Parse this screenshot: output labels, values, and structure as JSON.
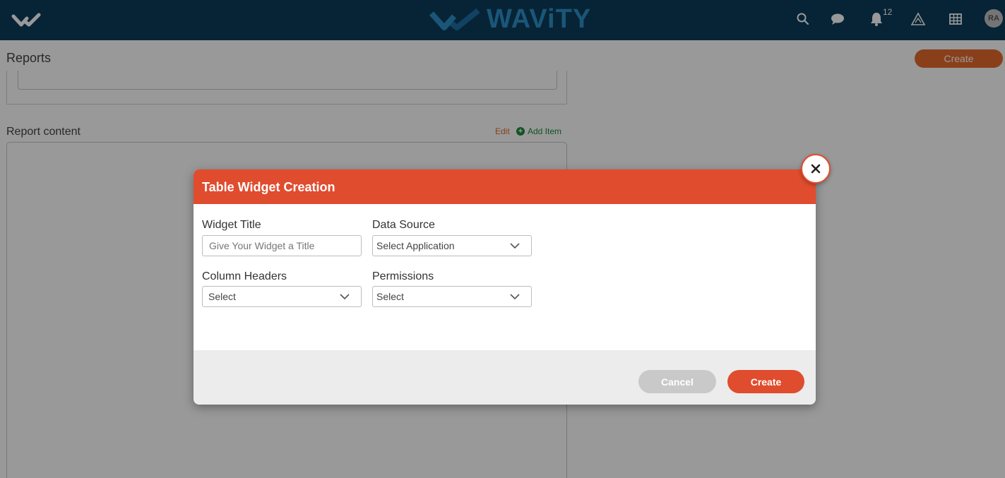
{
  "header": {
    "brand_name": "WAViTY",
    "notification_count": "12",
    "avatar_initials": "RA",
    "icons": [
      "search-icon",
      "chat-icon",
      "bell-icon",
      "alert-triangle-icon",
      "grid-icon"
    ]
  },
  "page": {
    "title": "Reports",
    "create_label": "Create",
    "report_content_label": "Report content",
    "edit_label": "Edit",
    "add_item_label": "Add Item"
  },
  "modal": {
    "title": "Table Widget Creation",
    "widget_title_label": "Widget Title",
    "widget_title_placeholder": "Give Your Widget a Title",
    "data_source_label": "Data Source",
    "data_source_value": "Select Application",
    "column_headers_label": "Column Headers",
    "column_headers_value": "Select",
    "permissions_label": "Permissions",
    "permissions_value": "Select",
    "cancel_label": "Cancel",
    "create_label": "Create"
  },
  "colors": {
    "topbar": "#0b3c5a",
    "brand": "#2e90c9",
    "modal_header": "#e04c2e",
    "accent_orange": "#e56a2c",
    "add_item_green": "#1f8a3a"
  }
}
